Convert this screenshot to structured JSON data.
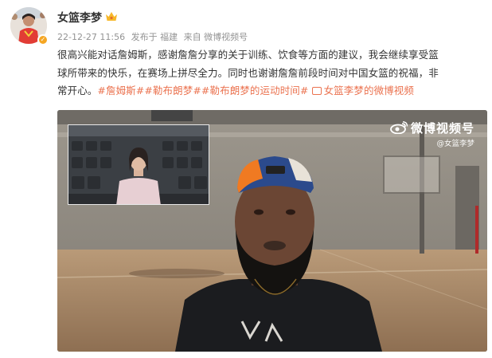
{
  "post": {
    "author": "女篮李梦",
    "timestamp": "22-12-27 11:56",
    "published_from": "发布于 福建",
    "source": "来自 微博视频号",
    "text_lines": [
      "很高兴能对话詹姆斯，感谢詹詹分享的关于训练、饮食等方面的建议，我会继续享受篮",
      "球所带来的快乐，在赛场上拼尽全力。同时也谢谢詹詹前段时间对中国女篮的祝福，非",
      "常开心。"
    ],
    "hashtags": [
      "#詹姆斯#",
      "#勒布朗梦#",
      "#勒布朗梦的运动时间#"
    ],
    "video_link": "女篮李梦的微博视频"
  },
  "video": {
    "watermark_title": "微博视频号",
    "watermark_author": "@女篮李梦"
  },
  "colors": {
    "accent": "#eb7350",
    "text": "#333333",
    "meta": "#939393"
  },
  "icons": {
    "vip": "crown-badge-icon",
    "video": "play-box-icon",
    "watermark": "weibo-eye-logo-icon"
  }
}
